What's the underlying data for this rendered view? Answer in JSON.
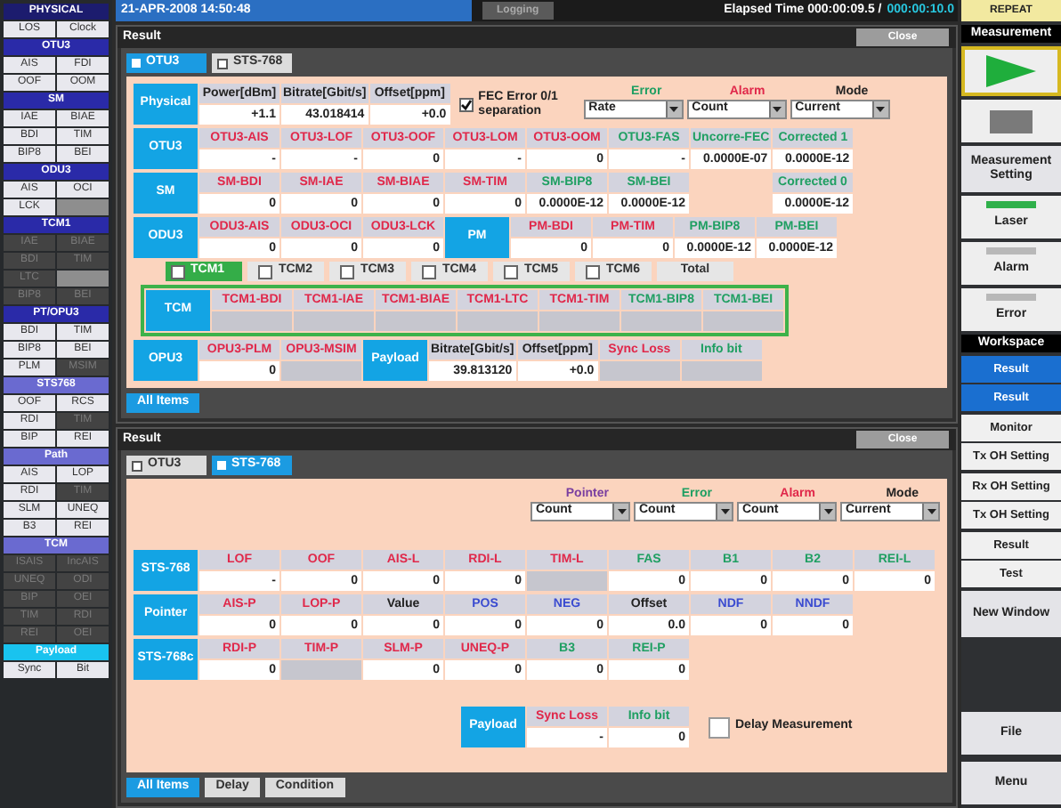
{
  "top_bar": {
    "date": "21-APR-2008 14:50:48",
    "logging": "Logging",
    "elapsed": "Elapsed Time 000:00:09.5 /",
    "total": "000:00:10.0",
    "repeat": "REPEAT"
  },
  "alarm_panel": [
    {
      "title": "PHYSICAL",
      "color": "#1c1c6e",
      "items": [
        {
          "label": "LOS",
          "dim": false
        },
        {
          "label": "Clock",
          "dim": false
        }
      ]
    },
    {
      "title": "OTU3",
      "color": "#2a2aa8",
      "items": [
        {
          "label": "AIS",
          "dim": false
        },
        {
          "label": "FDI",
          "dim": false
        },
        {
          "label": "OOF",
          "dim": false
        },
        {
          "label": "OOM",
          "dim": false
        }
      ]
    },
    {
      "title": "SM",
      "color": "#2a2aa8",
      "items": [
        {
          "label": "IAE",
          "dim": false
        },
        {
          "label": "BIAE",
          "dim": false
        },
        {
          "label": "BDI",
          "dim": false
        },
        {
          "label": "TIM",
          "dim": false
        },
        {
          "label": "BIP8",
          "dim": false
        },
        {
          "label": "BEI",
          "dim": false
        }
      ]
    },
    {
      "title": "ODU3",
      "color": "#2a2aa8",
      "items": [
        {
          "label": "AIS",
          "dim": false
        },
        {
          "label": "OCI",
          "dim": false
        },
        {
          "label": "LCK",
          "dim": false
        },
        {
          "kind": "blank"
        }
      ]
    },
    {
      "title": "TCM1",
      "color": "#2a2aa8",
      "items": [
        {
          "label": "IAE",
          "dim": true
        },
        {
          "label": "BIAE",
          "dim": true
        },
        {
          "label": "BDI",
          "dim": true
        },
        {
          "label": "TIM",
          "dim": true
        },
        {
          "label": "LTC",
          "dim": true
        },
        {
          "kind": "blank"
        },
        {
          "label": "BIP8",
          "dim": true
        },
        {
          "label": "BEI",
          "dim": true
        }
      ]
    },
    {
      "title": "PT/OPU3",
      "color": "#2a2aa8",
      "items": [
        {
          "label": "BDI",
          "dim": false
        },
        {
          "label": "TIM",
          "dim": false
        },
        {
          "label": "BIP8",
          "dim": false
        },
        {
          "label": "BEI",
          "dim": false
        },
        {
          "label": "PLM",
          "dim": false
        },
        {
          "label": "MSIM",
          "dim": true
        }
      ]
    },
    {
      "title": "STS768",
      "color": "#6a6ad0",
      "items": [
        {
          "label": "OOF",
          "dim": false
        },
        {
          "label": "RCS",
          "dim": false
        },
        {
          "label": "RDI",
          "dim": false
        },
        {
          "label": "TIM",
          "dim": true
        },
        {
          "label": "BIP",
          "dim": false
        },
        {
          "label": "REI",
          "dim": false
        }
      ]
    },
    {
      "title": "Path",
      "color": "#6a6ad0",
      "items": [
        {
          "label": "AIS",
          "dim": false
        },
        {
          "label": "LOP",
          "dim": false
        },
        {
          "label": "RDI",
          "dim": false
        },
        {
          "label": "TIM",
          "dim": true
        },
        {
          "label": "SLM",
          "dim": false
        },
        {
          "label": "UNEQ",
          "dim": false
        },
        {
          "label": "B3",
          "dim": false
        },
        {
          "label": "REI",
          "dim": false
        }
      ]
    },
    {
      "title": "TCM",
      "color": "#6a6ad0",
      "items": [
        {
          "label": "ISAIS",
          "dim": true
        },
        {
          "label": "IncAIS",
          "dim": true
        },
        {
          "label": "UNEQ",
          "dim": true
        },
        {
          "label": "ODI",
          "dim": true
        },
        {
          "label": "BIP",
          "dim": true
        },
        {
          "label": "OEI",
          "dim": true
        },
        {
          "label": "TIM",
          "dim": true
        },
        {
          "label": "RDI",
          "dim": true
        },
        {
          "label": "REI",
          "dim": true
        },
        {
          "label": "OEI",
          "dim": true
        }
      ]
    },
    {
      "title": "Payload",
      "color": "#19c3ef",
      "items": [
        {
          "label": "Sync",
          "dim": false
        },
        {
          "label": "Bit",
          "dim": false
        }
      ]
    }
  ],
  "windows": [
    {
      "title": "Result",
      "close": "Close",
      "tabs": [
        {
          "label": "OTU3",
          "selected": true
        },
        {
          "label": "STS-768",
          "selected": false
        }
      ],
      "fec": {
        "label": "FEC Error 0/1 separation",
        "checked": true
      },
      "selectors": [
        {
          "title": "Error",
          "color": "#1f9f62",
          "value": "Rate"
        },
        {
          "title": "Alarm",
          "color": "#e0284a",
          "value": "Count"
        },
        {
          "title": "Mode",
          "color": "#222222",
          "value": "Current"
        }
      ],
      "rows": [
        {
          "kind": "row",
          "cells": [
            {
              "kind": "header",
              "label": "Physical"
            },
            {
              "kind": "cell",
              "label": "Power[dBm]",
              "color": "#222222",
              "value": "+1.1"
            },
            {
              "kind": "cell",
              "label": "Bitrate[Gbit/s]",
              "color": "#222222",
              "value": "43.018414"
            },
            {
              "kind": "cell",
              "label": "Offset[ppm]",
              "color": "#222222",
              "value": "+0.0"
            }
          ]
        },
        {
          "kind": "row",
          "cells": [
            {
              "kind": "header",
              "label": "OTU3"
            },
            {
              "kind": "cell",
              "label": "OTU3-AIS",
              "color": "#e0284a",
              "value": "-"
            },
            {
              "kind": "cell",
              "label": "OTU3-LOF",
              "color": "#e0284a",
              "value": "-"
            },
            {
              "kind": "cell",
              "label": "OTU3-OOF",
              "color": "#e0284a",
              "value": "0"
            },
            {
              "kind": "cell",
              "label": "OTU3-LOM",
              "color": "#e0284a",
              "value": "-"
            },
            {
              "kind": "cell",
              "label": "OTU3-OOM",
              "color": "#e0284a",
              "value": "0"
            },
            {
              "kind": "cell",
              "label": "OTU3-FAS",
              "color": "#1f9f62",
              "value": "-"
            },
            {
              "kind": "cell",
              "label": "Uncorre-FEC",
              "color": "#1f9f62",
              "value": "0.0000E-07"
            },
            {
              "kind": "cell",
              "label": "Corrected 1",
              "color": "#1f9f62",
              "value": "0.0000E-12"
            }
          ]
        },
        {
          "kind": "row",
          "cells": [
            {
              "kind": "header",
              "label": "SM"
            },
            {
              "kind": "cell",
              "label": "SM-BDI",
              "color": "#e0284a",
              "value": "0"
            },
            {
              "kind": "cell",
              "label": "SM-IAE",
              "color": "#e0284a",
              "value": "0"
            },
            {
              "kind": "cell",
              "label": "SM-BIAE",
              "color": "#e0284a",
              "value": "0"
            },
            {
              "kind": "cell",
              "label": "SM-TIM",
              "color": "#e0284a",
              "value": "0"
            },
            {
              "kind": "cell",
              "label": "SM-BIP8",
              "color": "#1f9f62",
              "value": "0.0000E-12"
            },
            {
              "kind": "cell",
              "label": "SM-BEI",
              "color": "#1f9f62",
              "value": "0.0000E-12"
            },
            {
              "kind": "gap"
            },
            {
              "kind": "cell",
              "label": "Corrected 0",
              "color": "#1f9f62",
              "value": "0.0000E-12"
            }
          ]
        },
        {
          "kind": "row",
          "cells": [
            {
              "kind": "header",
              "label": "ODU3"
            },
            {
              "kind": "cell",
              "label": "ODU3-AIS",
              "color": "#e0284a",
              "value": "0"
            },
            {
              "kind": "cell",
              "label": "ODU3-OCI",
              "color": "#e0284a",
              "value": "0"
            },
            {
              "kind": "cell",
              "label": "ODU3-LCK",
              "color": "#e0284a",
              "value": "0"
            },
            {
              "kind": "header",
              "label": "PM"
            },
            {
              "kind": "cell",
              "label": "PM-BDI",
              "color": "#e0284a",
              "value": "0"
            },
            {
              "kind": "cell",
              "label": "PM-TIM",
              "color": "#e0284a",
              "value": "0"
            },
            {
              "kind": "cell",
              "label": "PM-BIP8",
              "color": "#1f9f62",
              "value": "0.0000E-12"
            },
            {
              "kind": "cell",
              "label": "PM-BEI",
              "color": "#1f9f62",
              "value": "0.0000E-12"
            }
          ]
        },
        {
          "kind": "tcm",
          "tabs": [
            {
              "label": "TCM1",
              "checked": false,
              "selected": true
            },
            {
              "label": "TCM2",
              "checked": false,
              "selected": false
            },
            {
              "label": "TCM3",
              "checked": false,
              "selected": false
            },
            {
              "label": "TCM4",
              "checked": false,
              "selected": false
            },
            {
              "label": "TCM5",
              "checked": false,
              "selected": false
            },
            {
              "label": "TCM6",
              "checked": false,
              "selected": false
            },
            {
              "label": "Total",
              "selected": false
            }
          ],
          "cells": [
            {
              "kind": "header",
              "label": "TCM"
            },
            {
              "kind": "cell",
              "label": "TCM1-BDI",
              "color": "#e0284a"
            },
            {
              "kind": "cell",
              "label": "TCM1-IAE",
              "color": "#e0284a"
            },
            {
              "kind": "cell",
              "label": "TCM1-BIAE",
              "color": "#e0284a"
            },
            {
              "kind": "cell",
              "label": "TCM1-LTC",
              "color": "#e0284a"
            },
            {
              "kind": "cell",
              "label": "TCM1-TIM",
              "color": "#e0284a"
            },
            {
              "kind": "cell",
              "label": "TCM1-BIP8",
              "color": "#1f9f62"
            },
            {
              "kind": "cell",
              "label": "TCM1-BEI",
              "color": "#1f9f62"
            }
          ]
        },
        {
          "kind": "row",
          "cells": [
            {
              "kind": "header",
              "label": "OPU3"
            },
            {
              "kind": "cell",
              "label": "OPU3-PLM",
              "color": "#e0284a",
              "value": "0"
            },
            {
              "kind": "cell",
              "label": "OPU3-MSIM",
              "color": "#e0284a"
            },
            {
              "kind": "header",
              "label": "Payload"
            },
            {
              "kind": "cell",
              "label": "Bitrate[Gbit/s]",
              "color": "#222222",
              "value": "39.813120"
            },
            {
              "kind": "cell",
              "label": "Offset[ppm]",
              "color": "#222222",
              "value": "+0.0"
            },
            {
              "kind": "cell",
              "label": "Sync Loss",
              "color": "#e0284a"
            },
            {
              "kind": "cell",
              "label": "Info bit",
              "color": "#1f9f62"
            }
          ]
        }
      ],
      "footer": [
        {
          "label": "All Items",
          "selected": true
        }
      ]
    },
    {
      "title": "Result",
      "close": "Close",
      "tabs": [
        {
          "label": "OTU3",
          "selected": false
        },
        {
          "label": "STS-768",
          "selected": true
        }
      ],
      "selectors": [
        {
          "title": "Pointer",
          "color": "#7a3fa0",
          "value": "Count"
        },
        {
          "title": "Error",
          "color": "#1f9f62",
          "value": "Count"
        },
        {
          "title": "Alarm",
          "color": "#e0284a",
          "value": "Count"
        },
        {
          "title": "Mode",
          "color": "#222222",
          "value": "Current"
        }
      ],
      "rows": [
        {
          "kind": "row",
          "cells": [
            {
              "kind": "header",
              "label": "STS-768"
            },
            {
              "kind": "cell",
              "label": "LOF",
              "color": "#e0284a",
              "value": "-"
            },
            {
              "kind": "cell",
              "label": "OOF",
              "color": "#e0284a",
              "value": "0"
            },
            {
              "kind": "cell",
              "label": "AIS-L",
              "color": "#e0284a",
              "value": "0"
            },
            {
              "kind": "cell",
              "label": "RDI-L",
              "color": "#e0284a",
              "value": "0"
            },
            {
              "kind": "cell",
              "label": "TIM-L",
              "color": "#e0284a"
            },
            {
              "kind": "cell",
              "label": "FAS",
              "color": "#1f9f62",
              "value": "0"
            },
            {
              "kind": "cell",
              "label": "B1",
              "color": "#1f9f62",
              "value": "0"
            },
            {
              "kind": "cell",
              "label": "B2",
              "color": "#1f9f62",
              "value": "0"
            },
            {
              "kind": "cell",
              "label": "REI-L",
              "color": "#1f9f62",
              "value": "0"
            }
          ]
        },
        {
          "kind": "row",
          "cells": [
            {
              "kind": "header",
              "label": "Pointer"
            },
            {
              "kind": "cell",
              "label": "AIS-P",
              "color": "#e0284a",
              "value": "0"
            },
            {
              "kind": "cell",
              "label": "LOP-P",
              "color": "#e0284a",
              "value": "0"
            },
            {
              "kind": "cell",
              "label": "Value",
              "color": "#222222",
              "value": "0"
            },
            {
              "kind": "cell",
              "label": "POS",
              "color": "#3a4bd0",
              "value": "0"
            },
            {
              "kind": "cell",
              "label": "NEG",
              "color": "#3a4bd0",
              "value": "0"
            },
            {
              "kind": "cell",
              "label": "Offset",
              "color": "#222222",
              "value": "0.0"
            },
            {
              "kind": "cell",
              "label": "NDF",
              "color": "#3a4bd0",
              "value": "0"
            },
            {
              "kind": "cell",
              "label": "NNDF",
              "color": "#3a4bd0",
              "value": "0"
            }
          ]
        },
        {
          "kind": "row",
          "cells": [
            {
              "kind": "header",
              "label": "STS-768c"
            },
            {
              "kind": "cell",
              "label": "RDI-P",
              "color": "#e0284a",
              "value": "0"
            },
            {
              "kind": "cell",
              "label": "TIM-P",
              "color": "#e0284a"
            },
            {
              "kind": "cell",
              "label": "SLM-P",
              "color": "#e0284a",
              "value": "0"
            },
            {
              "kind": "cell",
              "label": "UNEQ-P",
              "color": "#e0284a",
              "value": "0"
            },
            {
              "kind": "cell",
              "label": "B3",
              "color": "#1f9f62",
              "value": "0"
            },
            {
              "kind": "cell",
              "label": "REI-P",
              "color": "#1f9f62",
              "value": "0"
            }
          ]
        },
        {
          "kind": "payload",
          "cells": [
            {
              "kind": "gap"
            },
            {
              "kind": "gap"
            },
            {
              "kind": "gap"
            },
            {
              "kind": "gap"
            },
            {
              "kind": "header",
              "label": "Payload"
            },
            {
              "kind": "cell",
              "label": "Sync Loss",
              "color": "#e0284a",
              "value": "-"
            },
            {
              "kind": "cell",
              "label": "Info bit",
              "color": "#1f9f62",
              "value": "0"
            }
          ],
          "check": {
            "label": "Delay Measurement",
            "checked": false
          }
        }
      ],
      "footer": [
        {
          "label": "All Items",
          "selected": true
        },
        {
          "label": "Delay",
          "selected": false
        },
        {
          "label": "Condition",
          "selected": false
        }
      ]
    }
  ],
  "right_panel": {
    "items": [
      {
        "kind": "header",
        "label": "Measurement"
      },
      {
        "kind": "play"
      },
      {
        "kind": "stop"
      },
      {
        "kind": "button",
        "label": "Measurement Setting"
      },
      {
        "kind": "indicator",
        "label": "Laser",
        "color": "#2fb04a"
      },
      {
        "kind": "indicator",
        "label": "Alarm",
        "color": "#b8b8b8"
      },
      {
        "kind": "indicator",
        "label": "Error",
        "color": "#b8b8b8"
      },
      {
        "kind": "header",
        "label": "Workspace"
      },
      {
        "kind": "group",
        "buttons": [
          {
            "label": "Result",
            "selected": true
          },
          {
            "label": "Result",
            "selected": true
          }
        ]
      },
      {
        "kind": "group",
        "buttons": [
          {
            "label": "Monitor",
            "selected": false
          },
          {
            "label": "Tx OH Setting",
            "selected": false
          }
        ]
      },
      {
        "kind": "group",
        "buttons": [
          {
            "label": "Rx OH Setting",
            "selected": false
          },
          {
            "label": "Tx OH Setting",
            "selected": false
          }
        ]
      },
      {
        "kind": "group",
        "buttons": [
          {
            "label": "Result",
            "selected": false
          },
          {
            "label": "Test",
            "selected": false
          }
        ]
      },
      {
        "kind": "button",
        "label": "New Window"
      }
    ],
    "bottom": [
      {
        "label": "File"
      },
      {
        "label": "Menu"
      }
    ]
  }
}
